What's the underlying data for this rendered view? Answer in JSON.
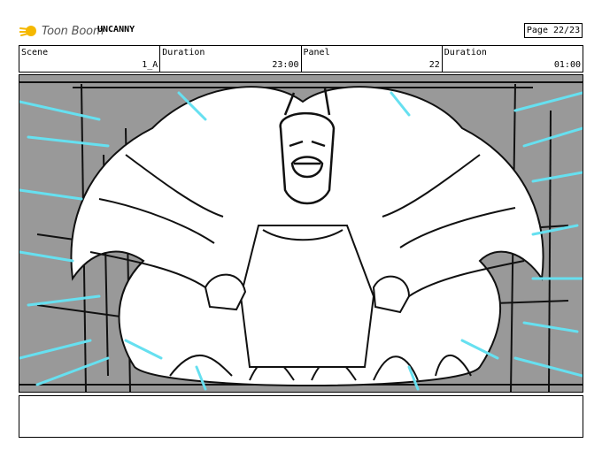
{
  "header": {
    "logo_text": "Toon Boom",
    "project_title": "UNCANNY",
    "page_label": "Page 22/23"
  },
  "info": {
    "scene_label": "Scene",
    "scene_value": "1_A",
    "duration_label": "Duration",
    "duration_value": "23:00",
    "panel_label": "Panel",
    "panel_value": "22",
    "panel_duration_label": "Duration",
    "panel_duration_value": "01:00"
  },
  "drawing": {
    "accent_color": "#66e0f0",
    "background_gray": "#999999"
  },
  "icons": {
    "logo": "toon-boom-logo-icon"
  }
}
